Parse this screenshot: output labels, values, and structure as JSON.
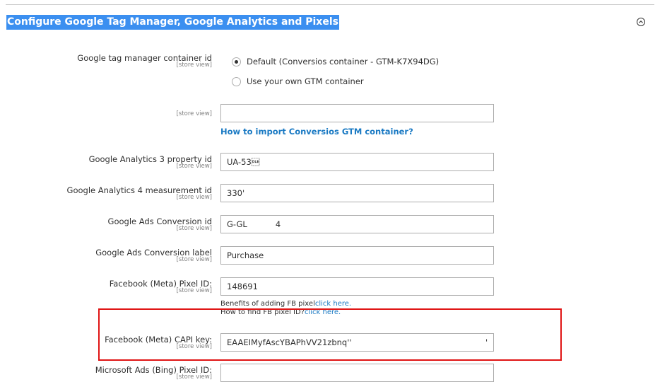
{
  "section": {
    "title": "Configure Google Tag Manager, Google Analytics and Pixels"
  },
  "scope_label": "[store view]",
  "gtm": {
    "label": "Google tag manager container id",
    "option_default": "Default (Conversios container - GTM-K7X94DG)",
    "option_own": "Use your own GTM container",
    "custom_value": "",
    "import_link": "How to import Conversios GTM container?"
  },
  "ga3": {
    "label": "Google Analytics 3 property id",
    "value": "UA-53\u0010"
  },
  "ga4": {
    "label": "Google Analytics 4 measurement id",
    "value": "330'"
  },
  "ads_conversion_id": {
    "label": "Google Ads Conversion id",
    "value_prefix": "G-GL",
    "value_suffix": "4"
  },
  "ads_conversion_label": {
    "label": "Google Ads Conversion label",
    "value": "Purchase"
  },
  "fb_pixel": {
    "label": "Facebook (Meta) Pixel ID:",
    "value": "148691",
    "note1_text": "Benefits of adding FB pixel",
    "note1_link": "click here.",
    "note2_text": "How to find FB pixel ID?",
    "note2_link": "click here."
  },
  "fb_capi": {
    "label": "Facebook (Meta) CAPI key:",
    "value": "EAAEIMyfAscYBAPhVV21zbnq''",
    "value_tail": "'"
  },
  "bing": {
    "label": "Microsoft Ads (Bing) Pixel ID:",
    "value": ""
  },
  "colors": {
    "highlight": "#e01414",
    "link": "#1979c3",
    "title_bg": "#3b8ff0"
  }
}
